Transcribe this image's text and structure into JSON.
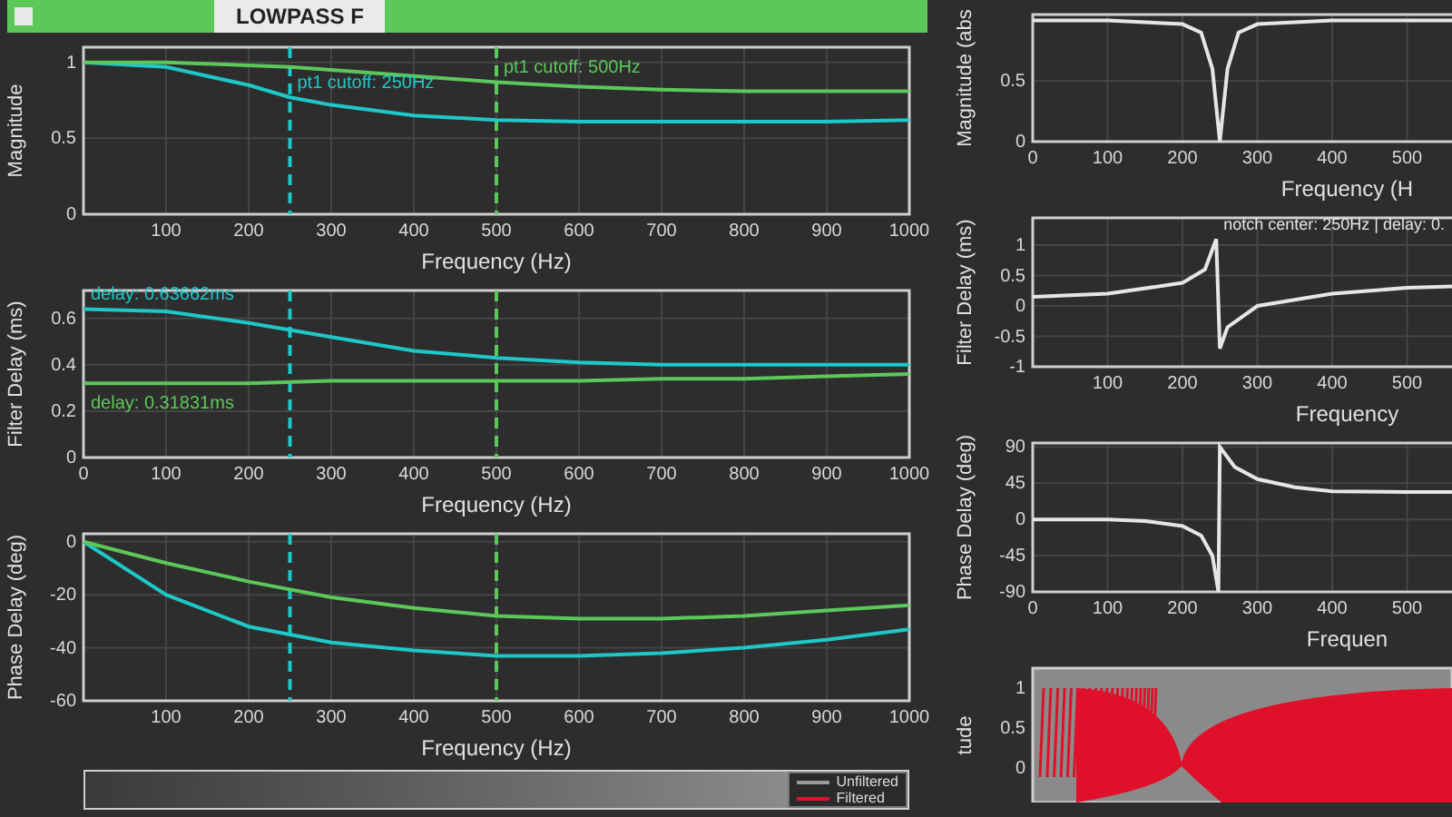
{
  "title_bar": {
    "title": "LOWPASS F"
  },
  "left_charts": [
    {
      "chart_data": {
        "type": "line",
        "xlabel": "Frequency (Hz)",
        "ylabel": "Magnitude",
        "grid": true,
        "x": [
          0,
          100,
          200,
          250,
          300,
          400,
          500,
          600,
          700,
          800,
          900,
          1000
        ],
        "series": [
          {
            "color": "#1ec8c8",
            "values": [
              1,
              0.97,
              0.85,
              0.77,
              0.72,
              0.65,
              0.62,
              0.61,
              0.61,
              0.61,
              0.61,
              0.62
            ]
          },
          {
            "color": "#5cc85a",
            "values": [
              1,
              1,
              0.98,
              0.97,
              0.95,
              0.91,
              0.87,
              0.84,
              0.82,
              0.81,
              0.81,
              0.81
            ]
          }
        ],
        "xlim": [
          0,
          1000
        ],
        "ylim": [
          0,
          1.1
        ],
        "xticks": [
          100,
          200,
          300,
          400,
          500,
          600,
          700,
          800,
          900,
          1000
        ],
        "yticks": [
          0,
          0.5,
          1
        ],
        "ref_lines": [
          {
            "axis": "x",
            "value": 250,
            "color": "#1ec8c8"
          },
          {
            "axis": "x",
            "value": 500,
            "color": "#5cc85a"
          }
        ],
        "annotations": [
          {
            "text": "pt1 cutoff: 250Hz",
            "x": 250,
            "y": 0.77
          },
          {
            "text": "pt1 cutoff: 500Hz",
            "x": 500,
            "y": 0.87
          }
        ]
      }
    },
    {
      "chart_data": {
        "type": "line",
        "xlabel": "Frequency (Hz)",
        "ylabel": "Filter Delay (ms)",
        "grid": true,
        "x": [
          0,
          100,
          200,
          300,
          400,
          500,
          600,
          700,
          800,
          900,
          1000
        ],
        "series": [
          {
            "color": "#1ec8c8",
            "values": [
              0.64,
              0.63,
              0.58,
              0.52,
              0.46,
              0.43,
              0.41,
              0.4,
              0.4,
              0.4,
              0.4
            ]
          },
          {
            "color": "#5cc85a",
            "values": [
              0.32,
              0.32,
              0.32,
              0.33,
              0.33,
              0.33,
              0.33,
              0.34,
              0.34,
              0.35,
              0.36
            ]
          }
        ],
        "xlim": [
          0,
          1000
        ],
        "ylim": [
          0,
          0.72
        ],
        "xticks": [
          0,
          100,
          200,
          300,
          400,
          500,
          600,
          700,
          800,
          900,
          1000
        ],
        "yticks": [
          0,
          0.2,
          0.4,
          0.6
        ],
        "ref_lines": [
          {
            "axis": "x",
            "value": 250,
            "color": "#1ec8c8"
          },
          {
            "axis": "x",
            "value": 500,
            "color": "#5cc85a"
          }
        ],
        "annotations": [
          {
            "text": "delay: 0.63662ms",
            "x": 0,
            "y": 0.64
          },
          {
            "text": "delay: 0.31831ms",
            "x": 0,
            "y": 0.32
          }
        ]
      }
    },
    {
      "chart_data": {
        "type": "line",
        "xlabel": "Frequency (Hz)",
        "ylabel": "Phase Delay (deg)",
        "grid": true,
        "x": [
          0,
          100,
          200,
          300,
          400,
          500,
          600,
          700,
          800,
          900,
          1000
        ],
        "series": [
          {
            "color": "#1ec8c8",
            "values": [
              0,
              -20,
              -32,
              -38,
              -41,
              -43,
              -43,
              -42,
              -40,
              -37,
              -33
            ]
          },
          {
            "color": "#5cc85a",
            "values": [
              0,
              -8,
              -15,
              -21,
              -25,
              -28,
              -29,
              -29,
              -28,
              -26,
              -24
            ]
          }
        ],
        "xlim": [
          0,
          1000
        ],
        "ylim": [
          -60,
          3
        ],
        "xticks": [
          100,
          200,
          300,
          400,
          500,
          600,
          700,
          800,
          900,
          1000
        ],
        "yticks": [
          0,
          -20,
          -40,
          -60
        ],
        "ref_lines": [
          {
            "axis": "x",
            "value": 250,
            "color": "#1ec8c8"
          },
          {
            "axis": "x",
            "value": 500,
            "color": "#5cc85a"
          }
        ]
      }
    }
  ],
  "signal_legend": [
    {
      "label": "Unfiltered",
      "color": "#9a9a9a"
    },
    {
      "label": "Filtered",
      "color": "#e0102a"
    }
  ],
  "right_charts": [
    {
      "chart_data": {
        "type": "line",
        "xlabel": "Frequency (H",
        "ylabel": "Magnitude (abs",
        "grid": true,
        "x": [
          0,
          100,
          200,
          225,
          240,
          250,
          260,
          275,
          300,
          400,
          500,
          560
        ],
        "series": [
          {
            "color": "#e6e6e6",
            "values": [
              1,
              1,
              0.97,
              0.9,
              0.6,
              0,
              0.6,
              0.9,
              0.97,
              1,
              1,
              1
            ]
          }
        ],
        "xlim": [
          0,
          560
        ],
        "ylim": [
          0,
          1.05
        ],
        "xticks": [
          0,
          100,
          200,
          300,
          400,
          500
        ],
        "yticks": [
          0,
          0.5
        ]
      }
    },
    {
      "chart_data": {
        "type": "line",
        "xlabel": "Frequency",
        "ylabel": "Filter Delay (ms)",
        "grid": true,
        "x": [
          0,
          100,
          200,
          230,
          245,
          250,
          260,
          300,
          400,
          500,
          560
        ],
        "series": [
          {
            "color": "#e6e6e6",
            "values": [
              0.15,
              0.2,
              0.38,
              0.6,
              1.1,
              -0.7,
              -0.35,
              0,
              0.2,
              0.3,
              0.32
            ]
          }
        ],
        "xlim": [
          0,
          560
        ],
        "ylim": [
          -1,
          1.45
        ],
        "xticks": [
          100,
          200,
          300,
          400,
          500
        ],
        "yticks": [
          -1,
          -0.5,
          0,
          0.5,
          1
        ],
        "annotations": [
          {
            "text": "notch center: 250Hz | delay: 0.",
            "x": 245,
            "y": 1.1
          }
        ]
      }
    },
    {
      "chart_data": {
        "type": "line",
        "xlabel": "Frequen",
        "ylabel": "Phase Delay (deg)",
        "grid": true,
        "x": [
          0,
          100,
          150,
          200,
          225,
          240,
          248,
          250,
          270,
          300,
          350,
          400,
          500,
          560
        ],
        "series": [
          {
            "color": "#e6e6e6",
            "values": [
              0,
              0,
              -2,
              -8,
              -20,
              -45,
              -90,
              90,
              65,
              50,
              40,
              35,
              34,
              34
            ]
          }
        ],
        "xlim": [
          0,
          560
        ],
        "ylim": [
          -90,
          95
        ],
        "xticks": [
          0,
          100,
          200,
          300,
          400,
          500
        ],
        "yticks": [
          -90,
          -45,
          0,
          45,
          90
        ]
      }
    }
  ],
  "signal_plot": {
    "ylabel": "tude",
    "yticks": [
      "1",
      "0.5",
      "0"
    ]
  }
}
